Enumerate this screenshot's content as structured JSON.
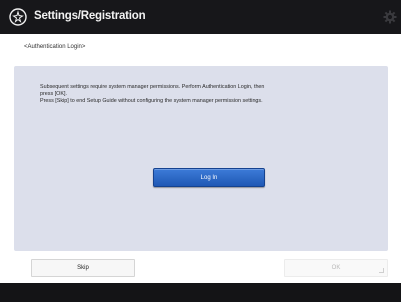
{
  "header": {
    "title": "Settings/Registration",
    "app_icon": "settings-registration-icon",
    "right_icon": "gear-icon"
  },
  "screen_label": "<Authentication Login>",
  "message": {
    "line1": "Subsequent settings require system manager permissions. Perform Authentication Login, then",
    "line2": "press [OK].",
    "line3": "Press [Skip] to end Setup Guide without configuring the system manager permission settings."
  },
  "buttons": {
    "login_label": "Log In",
    "skip_label": "Skip",
    "ok_label": "OK"
  },
  "colors": {
    "header_bg": "#17171a",
    "panel_bg": "#dcdfeb",
    "login_button": "#2a66c6",
    "footer_bg": "#141416"
  }
}
